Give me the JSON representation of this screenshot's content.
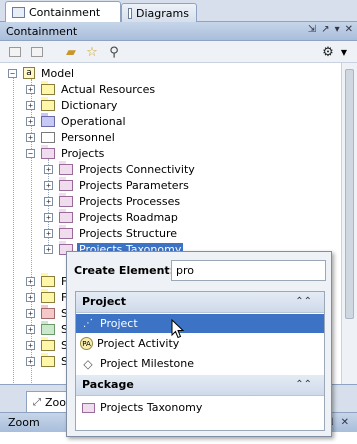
{
  "tabs": {
    "containment": "Containment",
    "diagrams": "Diagrams"
  },
  "panel": {
    "title": "Containment",
    "controls": [
      "⇲",
      "↗",
      "▾",
      "✕"
    ]
  },
  "toolbar": {
    "icons": [
      "package-back-icon",
      "package-forward-icon",
      "folder-open-icon",
      "star-icon",
      "search-icon",
      "gear-icon"
    ]
  },
  "tree": {
    "root": "Model",
    "items": [
      "Actual Resources",
      "Dictionary",
      "Operational",
      "Personnel",
      "Projects",
      "Projects Connectivity",
      "Projects Parameters",
      "Projects Processes",
      "Projects Roadmap",
      "Projects Structure",
      "Projects Taxonomy"
    ],
    "partial": [
      "F",
      "F",
      "S",
      "S",
      "S",
      "S"
    ]
  },
  "popup": {
    "label": "Create Element:",
    "value": "pro",
    "sections": [
      {
        "title": "Project",
        "items": [
          "Project",
          "Project Activity",
          "Project Milestone"
        ]
      },
      {
        "title": "Package",
        "items": [
          "Projects Taxonomy"
        ]
      }
    ]
  },
  "bottom": {
    "zoom_tab": "Zoo",
    "zoom_title": "Zoom",
    "zoom_controls": [
      "⇲",
      "✕"
    ]
  }
}
